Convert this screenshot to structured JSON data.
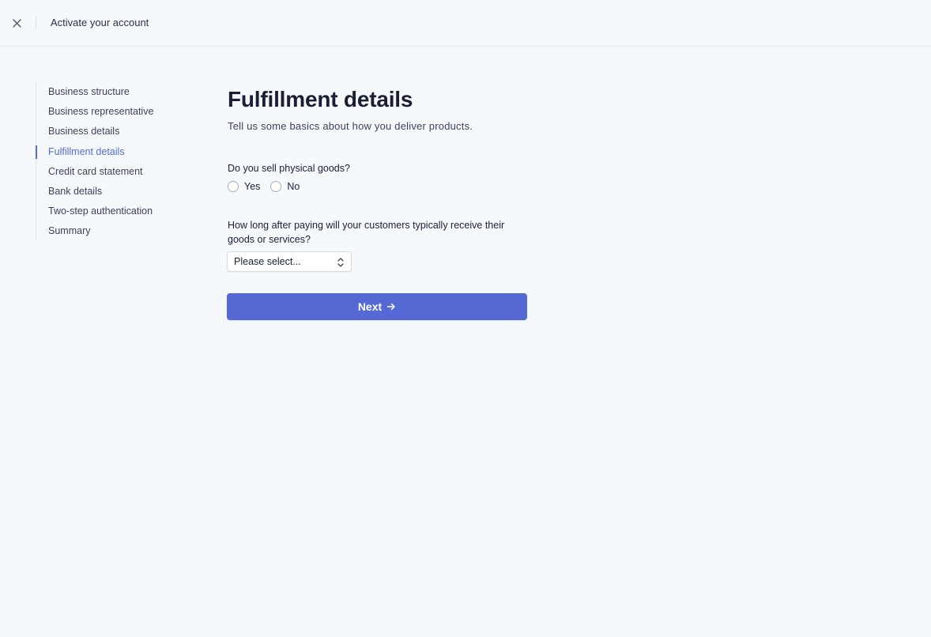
{
  "header": {
    "title": "Activate your account",
    "close_icon": "close-icon"
  },
  "sidebar": {
    "items": [
      {
        "label": "Business structure",
        "active": false
      },
      {
        "label": "Business representative",
        "active": false
      },
      {
        "label": "Business details",
        "active": false
      },
      {
        "label": "Fulfillment details",
        "active": true
      },
      {
        "label": "Credit card statement",
        "active": false
      },
      {
        "label": "Bank details",
        "active": false
      },
      {
        "label": "Two-step authentication",
        "active": false
      },
      {
        "label": "Summary",
        "active": false
      }
    ]
  },
  "main": {
    "title": "Fulfillment details",
    "subtitle": "Tell us some basics about how you deliver products.",
    "question1": {
      "label": "Do you sell physical goods?",
      "options": [
        "Yes",
        "No"
      ],
      "selected": null
    },
    "question2": {
      "label": "How long after paying will your customers typically receive their goods or services?",
      "select_value": "Please select..."
    },
    "next_button": "Next"
  },
  "colors": {
    "accent": "#5469d4",
    "background": "#f6f9fc"
  }
}
